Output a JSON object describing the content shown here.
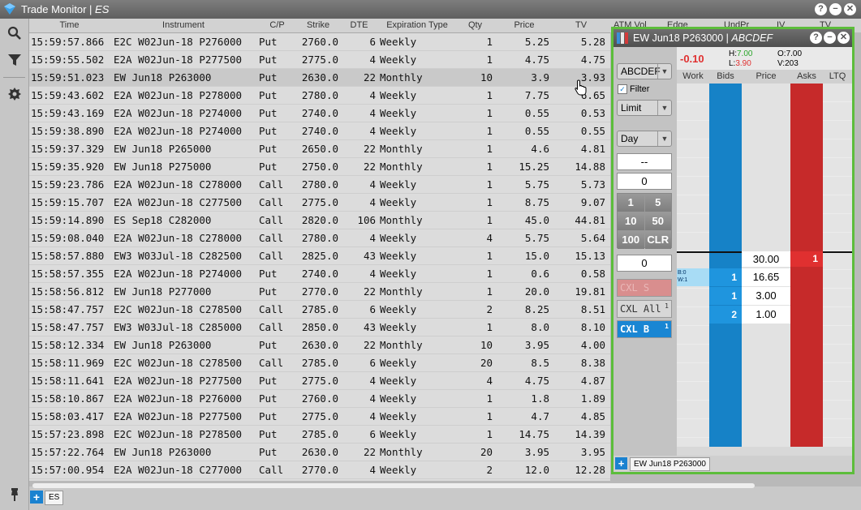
{
  "window": {
    "app_name": "Trade Monitor",
    "product": "ES"
  },
  "window_buttons": [
    "?",
    "−",
    "✕"
  ],
  "left_icons": [
    "search-icon",
    "filter-icon",
    "settings-icon",
    "pin-icon"
  ],
  "columns": [
    "Time",
    "Instrument",
    "C/P",
    "Strike",
    "DTE",
    "Expiration Type",
    "Qty",
    "Price",
    "TV",
    "ATM Vol",
    "Edge",
    "UndPr",
    "IV",
    "TV"
  ],
  "rows": [
    [
      "15:59:57.866",
      "E2C W02Jun-18 P276000",
      "Put",
      "2760.0",
      "6",
      "Weekly",
      "1",
      "5.25",
      "5.28"
    ],
    [
      "15:59:55.502",
      "E2A W02Jun-18 P277500",
      "Put",
      "2775.0",
      "4",
      "Weekly",
      "1",
      "4.75",
      "4.75"
    ],
    [
      "15:59:51.023",
      "EW Jun18 P263000",
      "Put",
      "2630.0",
      "22",
      "Monthly",
      "10",
      "3.9",
      "3.93"
    ],
    [
      "15:59:43.602",
      "E2A W02Jun-18 P278000",
      "Put",
      "2780.0",
      "4",
      "Weekly",
      "1",
      "7.75",
      "6.65"
    ],
    [
      "15:59:43.169",
      "E2A W02Jun-18 P274000",
      "Put",
      "2740.0",
      "4",
      "Weekly",
      "1",
      "0.55",
      "0.53"
    ],
    [
      "15:59:38.890",
      "E2A W02Jun-18 P274000",
      "Put",
      "2740.0",
      "4",
      "Weekly",
      "1",
      "0.55",
      "0.55"
    ],
    [
      "15:59:37.329",
      "EW Jun18 P265000",
      "Put",
      "2650.0",
      "22",
      "Monthly",
      "1",
      "4.6",
      "4.81"
    ],
    [
      "15:59:35.920",
      "EW Jun18 P275000",
      "Put",
      "2750.0",
      "22",
      "Monthly",
      "1",
      "15.25",
      "14.88"
    ],
    [
      "15:59:23.786",
      "E2A W02Jun-18 C278000",
      "Call",
      "2780.0",
      "4",
      "Weekly",
      "1",
      "5.75",
      "5.73"
    ],
    [
      "15:59:15.707",
      "E2A W02Jun-18 C277500",
      "Call",
      "2775.0",
      "4",
      "Weekly",
      "1",
      "8.75",
      "9.07"
    ],
    [
      "15:59:14.890",
      "ES Sep18 C282000",
      "Call",
      "2820.0",
      "106",
      "Monthly",
      "1",
      "45.0",
      "44.81"
    ],
    [
      "15:59:08.040",
      "E2A W02Jun-18 C278000",
      "Call",
      "2780.0",
      "4",
      "Weekly",
      "4",
      "5.75",
      "5.64"
    ],
    [
      "15:58:57.880",
      "EW3 W03Jul-18 C282500",
      "Call",
      "2825.0",
      "43",
      "Weekly",
      "1",
      "15.0",
      "15.13"
    ],
    [
      "15:58:57.355",
      "E2A W02Jun-18 P274000",
      "Put",
      "2740.0",
      "4",
      "Weekly",
      "1",
      "0.6",
      "0.58"
    ],
    [
      "15:58:56.812",
      "EW Jun18 P277000",
      "Put",
      "2770.0",
      "22",
      "Monthly",
      "1",
      "20.0",
      "19.81"
    ],
    [
      "15:58:47.757",
      "E2C W02Jun-18 C278500",
      "Call",
      "2785.0",
      "6",
      "Weekly",
      "2",
      "8.25",
      "8.51"
    ],
    [
      "15:58:47.757",
      "EW3 W03Jul-18 C285000",
      "Call",
      "2850.0",
      "43",
      "Weekly",
      "1",
      "8.0",
      "8.10"
    ],
    [
      "15:58:12.334",
      "EW Jun18 P263000",
      "Put",
      "2630.0",
      "22",
      "Monthly",
      "10",
      "3.95",
      "4.00"
    ],
    [
      "15:58:11.969",
      "E2C W02Jun-18 C278500",
      "Call",
      "2785.0",
      "6",
      "Weekly",
      "20",
      "8.5",
      "8.38"
    ],
    [
      "15:58:11.641",
      "E2A W02Jun-18 P277500",
      "Put",
      "2775.0",
      "4",
      "Weekly",
      "4",
      "4.75",
      "4.87"
    ],
    [
      "15:58:10.867",
      "E2A W02Jun-18 P276000",
      "Put",
      "2760.0",
      "4",
      "Weekly",
      "1",
      "1.8",
      "1.89"
    ],
    [
      "15:58:03.417",
      "E2A W02Jun-18 P277500",
      "Put",
      "2775.0",
      "4",
      "Weekly",
      "1",
      "4.7",
      "4.85"
    ],
    [
      "15:57:23.898",
      "E2C W02Jun-18 P278500",
      "Put",
      "2785.0",
      "6",
      "Weekly",
      "1",
      "14.75",
      "14.39"
    ],
    [
      "15:57:22.764",
      "EW Jun18 P263000",
      "Put",
      "2630.0",
      "22",
      "Monthly",
      "20",
      "3.95",
      "3.95"
    ],
    [
      "15:57:00.954",
      "E2A W02Jun-18 C277000",
      "Call",
      "2770.0",
      "4",
      "Weekly",
      "2",
      "12.0",
      "12.28"
    ]
  ],
  "selected_row": 2,
  "bottom_tabs": {
    "add": "+",
    "tab": "ES"
  },
  "ladder": {
    "instrument": "EW Jun18 P263000",
    "account": "ABCDEF",
    "buttons": [
      "?",
      "−",
      "✕"
    ],
    "change": "-0.10",
    "high_label": "H:",
    "high": "7.00",
    "low_label": "L:",
    "low": "3.90",
    "open_label": "O:",
    "open": "7.00",
    "volume_label": "V:",
    "volume": "203",
    "account_select": "ABCDEF",
    "filter_label": "Filter",
    "order_type": "Limit",
    "tif": "Day",
    "price_box": "--",
    "qty_box": "0",
    "keypad": [
      "1",
      "5",
      "10",
      "50",
      "100",
      "CLR"
    ],
    "offset_box": "0",
    "cxl_s": "CXL S",
    "cxl_all": "CXL All",
    "cxl_all_count": "1",
    "cxl_b": "CXL B",
    "cxl_b_count": "1",
    "columns": [
      "Work",
      "Bids",
      "Price",
      "Asks",
      "LTQ"
    ],
    "work_b": "B:0",
    "work_w": "W:1",
    "prices": [
      "30.00",
      "16.65",
      "3.00",
      "1.00"
    ],
    "bids": [
      "1",
      "1",
      "2"
    ],
    "asks": [
      "1"
    ],
    "tab_add": "+",
    "tab_label": "EW Jun18 P263000",
    "colors": {
      "bid": "#1682c7",
      "ask": "#c62a2a",
      "border": "#5cbd3b",
      "change": "#e03030"
    }
  }
}
